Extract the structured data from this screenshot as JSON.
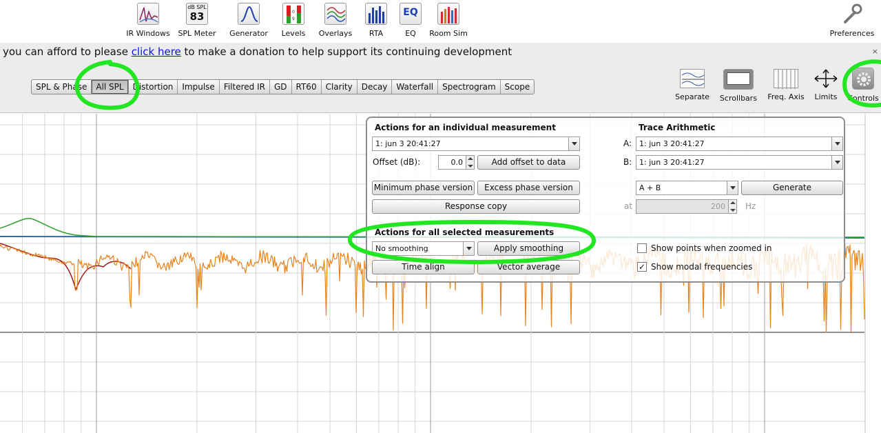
{
  "toolbar": {
    "items": [
      {
        "label": "IR Windows",
        "icon": "ir-windows-icon"
      },
      {
        "label": "SPL Meter",
        "icon": "spl-meter-icon",
        "icon_top": "dB SPL",
        "icon_value": "83"
      },
      {
        "label": "Generator",
        "icon": "generator-icon"
      },
      {
        "label": "Levels",
        "icon": "levels-icon"
      },
      {
        "label": "Overlays",
        "icon": "overlays-icon"
      },
      {
        "label": "RTA",
        "icon": "rta-icon"
      },
      {
        "label": "EQ",
        "icon": "eq-icon",
        "icon_text": "EQ"
      },
      {
        "label": "Room Sim",
        "icon": "room-sim-icon"
      }
    ],
    "preferences": "Preferences"
  },
  "banner": {
    "before": "you can afford to please ",
    "link": "click here",
    "after": " to make a donation to help support its continuing development",
    "close": "×"
  },
  "tabs": [
    "SPL & Phase",
    "All SPL",
    "Distortion",
    "Impulse",
    "Filtered IR",
    "GD",
    "RT60",
    "Clarity",
    "Decay",
    "Waterfall",
    "Spectrogram",
    "Scope"
  ],
  "selected_tab": "All SPL",
  "right_tools": [
    "Separate",
    "Scrollbars",
    "Freq. Axis",
    "Limits",
    "Controls"
  ],
  "panel": {
    "individual_title": "Actions for an individual measurement",
    "measurement_select": "1: jun 3 20:41:27",
    "offset_label": "Offset (dB):",
    "offset_value": "0.0",
    "add_offset": "Add offset to data",
    "min_phase": "Minimum phase version",
    "excess_phase": "Excess phase version",
    "response_copy": "Response copy",
    "all_title": "Actions for all selected measurements",
    "smoothing_select": "No  smoothing",
    "apply_smoothing": "Apply smoothing",
    "time_align": "Time align",
    "vector_average": "Vector average",
    "trace_title": "Trace Arithmetic",
    "a_label": "A:",
    "a_value": "1: jun 3 20:41:27",
    "b_label": "B:",
    "b_value": "1: jun 3 20:41:27",
    "op_select": "A + B",
    "generate": "Generate",
    "at_label": "at",
    "at_value": "200",
    "hz_label": "Hz",
    "show_points": "Show points when zoomed in",
    "show_points_checked": false,
    "show_modal": "Show modal frequencies",
    "show_modal_checked": true,
    "check_mark": "✓"
  },
  "colors": {
    "highlight": "#22e622",
    "orange_trace": "#e8821a",
    "green_trace": "#2ea02e",
    "red_trace": "#a01818",
    "blue_trace": "#1f6fb0",
    "link": "#0a14d8"
  }
}
